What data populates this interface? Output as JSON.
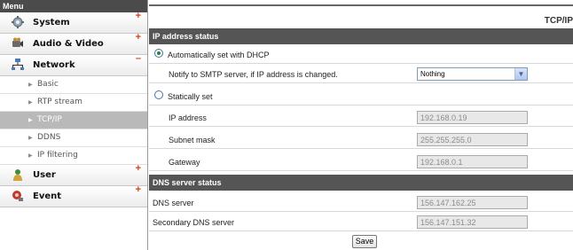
{
  "sidebar": {
    "title": "Menu",
    "items": [
      {
        "label": "System",
        "sign": "+",
        "icon": "gear-icon"
      },
      {
        "label": "Audio & Video",
        "sign": "+",
        "icon": "camera-icon"
      },
      {
        "label": "Network",
        "sign": "–",
        "icon": "network-icon"
      },
      {
        "label": "User",
        "sign": "+",
        "icon": "user-icon"
      },
      {
        "label": "Event",
        "sign": "+",
        "icon": "event-icon"
      }
    ],
    "network_sub": [
      {
        "label": "Basic",
        "active": false
      },
      {
        "label": "RTP stream",
        "active": false
      },
      {
        "label": "TCP/IP",
        "active": true
      },
      {
        "label": "DDNS",
        "active": false
      },
      {
        "label": "IP filtering",
        "active": false
      }
    ]
  },
  "main": {
    "page_title": "TCP/IP",
    "ip_section": {
      "title": "IP address status",
      "dhcp_label": "Automatically set with DHCP",
      "dhcp_selected": true,
      "notify_label": "Notify to SMTP server, if IP address is changed.",
      "notify_value": "Nothing",
      "static_label": "Statically set",
      "static_selected": false,
      "ip_label": "IP address",
      "ip_value": "192.168.0.19",
      "subnet_label": "Subnet mask",
      "subnet_value": "255.255.255.0",
      "gateway_label": "Gateway",
      "gateway_value": "192.168.0.1"
    },
    "dns_section": {
      "title": "DNS server status",
      "dns_label": "DNS server",
      "dns_value": "156.147.162.25",
      "secondary_label": "Secondary DNS server",
      "secondary_value": "156.147.151.32"
    },
    "save_label": "Save"
  },
  "colors": {
    "section_bar": "#555555",
    "menu_sign": "#d43c12",
    "active_sub": "#b9b9b9"
  }
}
